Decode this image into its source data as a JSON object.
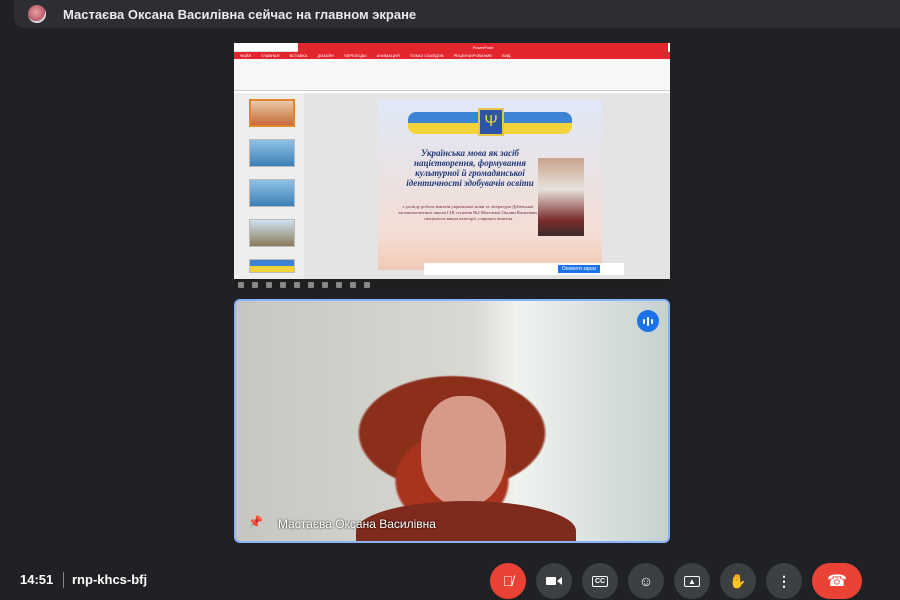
{
  "banner": {
    "text": "Мастаєва Оксана Василівна сейчас на главном экране"
  },
  "presentation": {
    "app_title": "PowerPoint",
    "ribbon_tabs": [
      "ФАЙЛ",
      "ГЛАВНАЯ",
      "ВСТАВКА",
      "ДИЗАЙН",
      "ПЕРЕХОДЫ",
      "АНИМАЦИЯ",
      "ПОКАЗ СЛАЙДОВ",
      "РЕЦЕНЗИРОВАНИЕ",
      "ВИД"
    ],
    "slide_title": "Українська мова як засіб націєтворення, формування культурної й громадянської ідентичності здобувачів освіти",
    "slide_subtitle": "з досвіду роботи вчителя української мови та літератури Дубенської загальноосвітньої школи I-III ступенів №2 Мастаєвої Оксани Василівни, спеціаліста вищої категорії, старшого вчителя",
    "notice_button": "Оновити зараз"
  },
  "participant": {
    "name": "Мастаєва Оксана Василівна",
    "speaking": true
  },
  "bottom_bar": {
    "time": "14:51",
    "meeting_code": "rnp-khcs-bfj"
  },
  "controls": [
    {
      "name": "microphone-off",
      "icon": "mic-off-icon"
    },
    {
      "name": "camera",
      "icon": "video-icon"
    },
    {
      "name": "captions",
      "icon": "cc-icon"
    },
    {
      "name": "reactions",
      "icon": "emoji-icon"
    },
    {
      "name": "present",
      "icon": "present-icon"
    },
    {
      "name": "raise-hand",
      "icon": "hand-icon"
    },
    {
      "name": "more-options",
      "icon": "more-icon"
    },
    {
      "name": "leave-call",
      "icon": "phone-hangup-icon"
    }
  ],
  "colors": {
    "background": "#202124",
    "accent": "#8ab4f8",
    "danger": "#ea4335",
    "speaking": "#1a73e8"
  }
}
